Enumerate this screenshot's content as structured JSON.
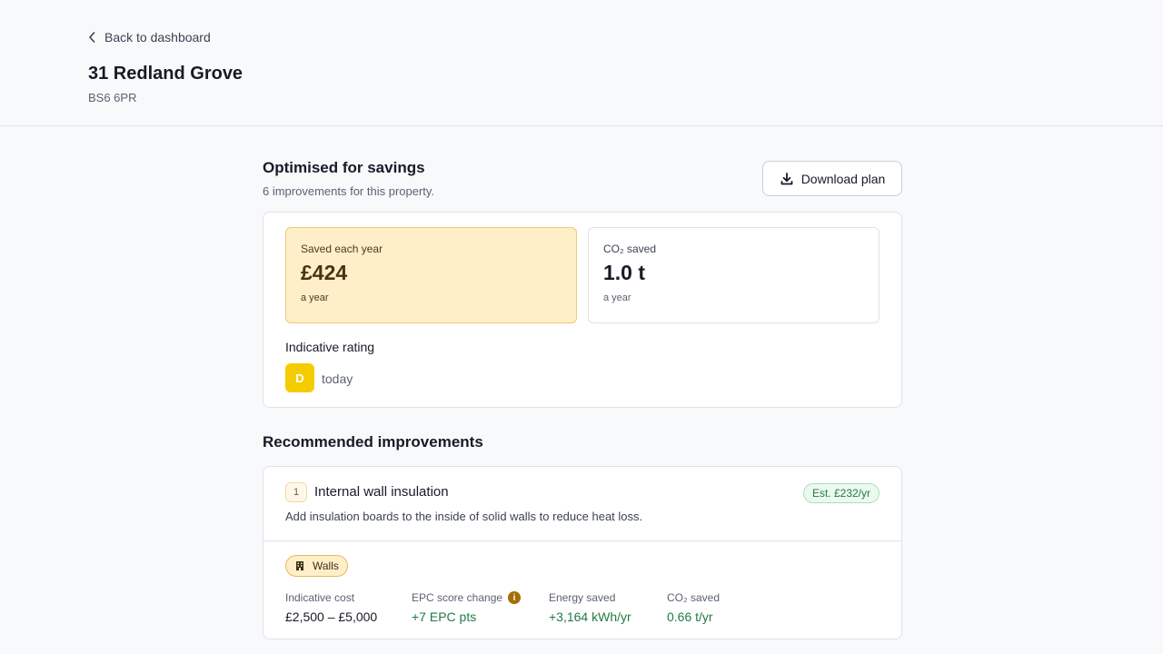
{
  "header": {
    "back_label": "Back to dashboard",
    "title": "31 Redland Grove",
    "postcode": "BS6 6PR"
  },
  "plan": {
    "title": "Optimised for savings",
    "subtitle": "6 improvements for this property.",
    "download_label": "Download plan"
  },
  "summary": {
    "savings": {
      "label": "Saved each year",
      "value": "£424",
      "note": "a year"
    },
    "co2": {
      "label": "CO₂ saved",
      "value": "1.0 t",
      "note": "a year"
    },
    "rating_title": "Indicative rating",
    "rating_letter": "D",
    "rating_when": "today",
    "rating_color": "#f5cc00"
  },
  "recommendations": {
    "title": "Recommended improvements",
    "items": [
      {
        "number": "1",
        "name": "Internal wall insulation",
        "estimate": "Est. £232/yr",
        "description": "Add insulation boards to the inside of solid walls to reduce heat loss.",
        "tag": "Walls",
        "tag_icon": "building-icon",
        "metrics": [
          {
            "label": "Indicative cost",
            "value": "£2,500 – £5,000"
          },
          {
            "label": "EPC score change",
            "value": "+7 EPC pts",
            "info": "i"
          },
          {
            "label": "Energy saved",
            "value": "+3,164 kWh/yr"
          },
          {
            "label": "CO₂ saved",
            "value": "0.66 t/yr"
          }
        ]
      }
    ]
  },
  "colors": {
    "accent_savings": "#feefc8",
    "positive_green": "#227a44"
  }
}
